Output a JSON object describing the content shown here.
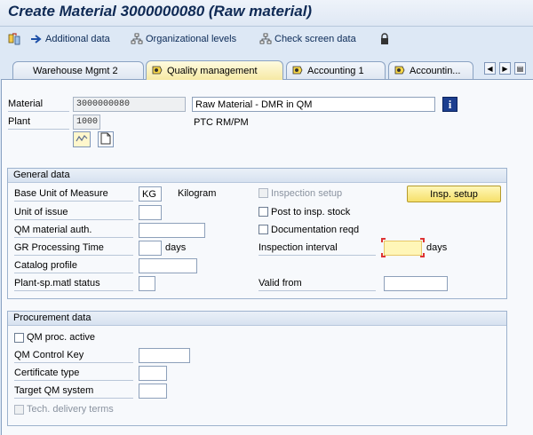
{
  "window": {
    "title": "Create Material 3000000080 (Raw material)"
  },
  "toolbar": {
    "items": [
      {
        "label": "",
        "icon": "switch-view-icon"
      },
      {
        "label": "Additional data",
        "icon": "arrow-right-icon"
      },
      {
        "label": "Organizational levels",
        "icon": "org-levels-icon"
      },
      {
        "label": "Check screen data",
        "icon": "check-screen-icon"
      },
      {
        "label": "",
        "icon": "lock-icon"
      }
    ]
  },
  "tabs": [
    {
      "label": "Warehouse Mgmt 2",
      "active": false
    },
    {
      "label": "Quality management",
      "active": true
    },
    {
      "label": "Accounting 1",
      "active": false
    },
    {
      "label": "Accountin...",
      "active": false
    }
  ],
  "header": {
    "material_label": "Material",
    "material_value": "3000000080",
    "material_desc": "Raw Material - DMR in QM",
    "plant_label": "Plant",
    "plant_value": "1000",
    "plant_desc": "PTC RM/PM"
  },
  "general": {
    "title": "General data",
    "base_uom_label": "Base Unit of Measure",
    "base_uom_value": "KG",
    "base_uom_text": "Kilogram",
    "unit_issue_label": "Unit of issue",
    "unit_issue_value": "",
    "qm_auth_label": "QM material auth.",
    "qm_auth_value": "",
    "gr_time_label": "GR Processing Time",
    "gr_time_value": "",
    "days_text": "days",
    "catalog_label": "Catalog profile",
    "catalog_value": "",
    "status_label": "Plant-sp.matl status",
    "status_value": "",
    "insp_setup_label": "Inspection setup",
    "insp_setup_checked": false,
    "post_insp_label": "Post to insp. stock",
    "post_insp_checked": false,
    "doc_reqd_label": "Documentation reqd",
    "doc_reqd_checked": false,
    "insp_interval_label": "Inspection interval",
    "insp_interval_value": "",
    "insp_interval_unit": "days",
    "valid_from_label": "Valid from",
    "valid_from_value": "",
    "insp_button": "Insp. setup"
  },
  "procurement": {
    "title": "Procurement data",
    "qm_active_label": "QM proc. active",
    "qm_active_checked": false,
    "control_key_label": "QM Control Key",
    "control_key_value": "",
    "cert_type_label": "Certificate type",
    "cert_type_value": "",
    "target_label": "Target QM system",
    "target_value": "",
    "tech_label": "Tech. delivery terms",
    "tech_checked": false
  },
  "colors": {
    "accent": "#0f2a55",
    "active_tab": "#f6e9a4",
    "required_field": "#fff6b8"
  }
}
